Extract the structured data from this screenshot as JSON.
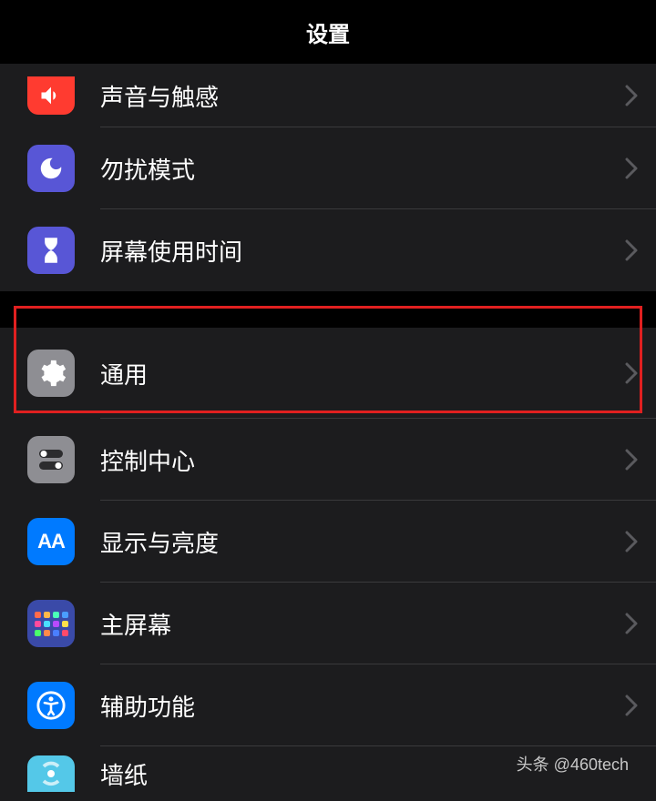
{
  "header": {
    "title": "设置"
  },
  "group1": {
    "items": [
      {
        "label": "声音与触感",
        "icon": "sounds"
      },
      {
        "label": "勿扰模式",
        "icon": "dnd"
      },
      {
        "label": "屏幕使用时间",
        "icon": "screentime"
      }
    ]
  },
  "group2": {
    "items": [
      {
        "label": "通用",
        "icon": "general"
      },
      {
        "label": "控制中心",
        "icon": "control"
      },
      {
        "label": "显示与亮度",
        "icon": "display"
      },
      {
        "label": "主屏幕",
        "icon": "home"
      },
      {
        "label": "辅助功能",
        "icon": "accessibility"
      },
      {
        "label": "墙纸",
        "icon": "wallpaper"
      }
    ]
  },
  "watermark": "头条 @460tech",
  "highlighted_item": "通用"
}
